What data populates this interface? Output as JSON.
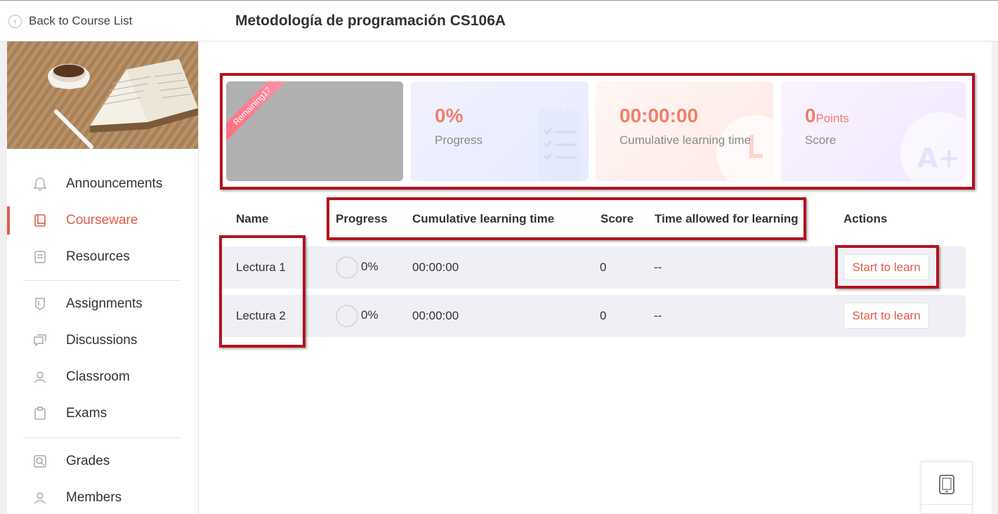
{
  "header": {
    "back_label": "Back to Course List",
    "course_title": "Metodología de programación CS106A"
  },
  "sidebar": {
    "items": [
      {
        "label": "Announcements",
        "icon": "bell-icon"
      },
      {
        "label": "Courseware",
        "icon": "book-icon",
        "active": true
      },
      {
        "label": "Resources",
        "icon": "resources-icon"
      },
      {
        "label": "Assignments",
        "icon": "assignment-icon"
      },
      {
        "label": "Discussions",
        "icon": "discussion-icon"
      },
      {
        "label": "Classroom",
        "icon": "classroom-icon"
      },
      {
        "label": "Exams",
        "icon": "exam-icon"
      },
      {
        "label": "Grades",
        "icon": "grades-icon"
      },
      {
        "label": "Members",
        "icon": "members-icon"
      }
    ]
  },
  "stats": {
    "ribbon": "Remaining17",
    "progress_value": "0%",
    "progress_label": "Progress",
    "time_value": "00:00:00",
    "time_label": "Cumulative learning time",
    "score_value": "0",
    "score_unit": "Points",
    "score_label": "Score"
  },
  "table": {
    "headers": [
      "Name",
      "Progress",
      "Cumulative learning time",
      "Score",
      "Time allowed for learning",
      "Actions"
    ],
    "rows": [
      {
        "name": "Lectura 1",
        "progress": "0%",
        "time": "00:00:00",
        "score": "0",
        "allowed": "--",
        "action": "Start to learn"
      },
      {
        "name": "Lectura 2",
        "progress": "0%",
        "time": "00:00:00",
        "score": "0",
        "allowed": "--",
        "action": "Start to learn"
      }
    ]
  },
  "colors": {
    "accent": "#e05b4b",
    "highlight_box": "#b3121f",
    "stat_value": "#f17f6a"
  }
}
